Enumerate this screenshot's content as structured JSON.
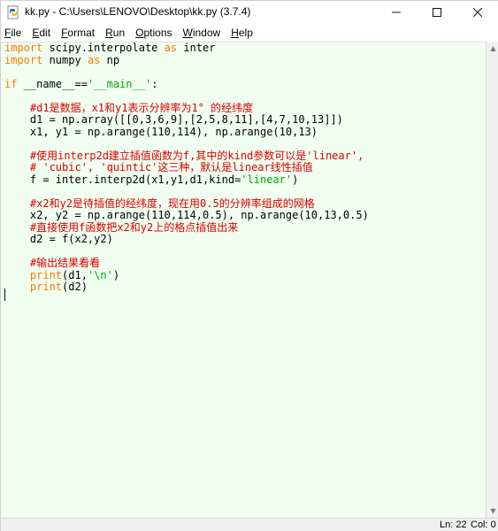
{
  "window": {
    "title": "kk.py - C:\\Users\\LENOVO\\Desktop\\kk.py (3.7.4)",
    "icon": "python-file-icon"
  },
  "menu": [
    "File",
    "Edit",
    "Format",
    "Run",
    "Options",
    "Window",
    "Help"
  ],
  "code": {
    "lines": [
      [
        {
          "t": "import",
          "c": "kw"
        },
        {
          "t": " scipy.interpolate ",
          "c": ""
        },
        {
          "t": "as",
          "c": "kw"
        },
        {
          "t": " inter",
          "c": ""
        }
      ],
      [
        {
          "t": "import",
          "c": "kw"
        },
        {
          "t": " numpy ",
          "c": ""
        },
        {
          "t": "as",
          "c": "kw"
        },
        {
          "t": " np",
          "c": ""
        }
      ],
      [],
      [
        {
          "t": "if",
          "c": "kw"
        },
        {
          "t": " __name__==",
          "c": ""
        },
        {
          "t": "'__main__'",
          "c": "str"
        },
        {
          "t": ":",
          "c": ""
        }
      ],
      [],
      [
        {
          "t": "    #d1是数据，x1和y1表示分辨率为1° 的经纬度",
          "c": "cm"
        }
      ],
      [
        {
          "t": "    d1 = np.array([[0,3,6,9],[2,5,8,11],[4,7,10,13]])",
          "c": ""
        }
      ],
      [
        {
          "t": "    x1, y1 = np.arange(110,114), np.arange(10,13)",
          "c": ""
        }
      ],
      [],
      [
        {
          "t": "    #使用interp2d建立插值函数为f,其中的kind参数可以是'linear',",
          "c": "cm"
        }
      ],
      [
        {
          "t": "    # 'cubic', 'quintic'这三种，默认是linear线性插值",
          "c": "cm"
        }
      ],
      [
        {
          "t": "    f = inter.interp2d(x1,y1,d1,kind=",
          "c": ""
        },
        {
          "t": "'linear'",
          "c": "str"
        },
        {
          "t": ")",
          "c": ""
        }
      ],
      [],
      [
        {
          "t": "    #x2和y2是待插值的经纬度，现在用0.5的分辨率组成的网格",
          "c": "cm"
        }
      ],
      [
        {
          "t": "    x2, y2 = np.arange(110,114,0.5), np.arange(10,13,0.5)",
          "c": ""
        }
      ],
      [
        {
          "t": "    #直接使用f函数把x2和y2上的格点插值出来",
          "c": "cm"
        }
      ],
      [
        {
          "t": "    d2 = f(x2,y2)",
          "c": ""
        }
      ],
      [],
      [
        {
          "t": "    #输出结果看看",
          "c": "cm"
        }
      ],
      [
        {
          "t": "    print",
          "c": "kw"
        },
        {
          "t": "(d1,",
          "c": ""
        },
        {
          "t": "'\\n'",
          "c": "str"
        },
        {
          "t": ")",
          "c": ""
        }
      ],
      [
        {
          "t": "    print",
          "c": "kw"
        },
        {
          "t": "(d2)",
          "c": ""
        }
      ],
      []
    ]
  },
  "status": {
    "line": "Ln: 22",
    "col": "Col: 0"
  },
  "colors": {
    "editor_bg": "#f0fff0",
    "keyword": "#ff7700",
    "string": "#00aa00",
    "comment": "#dd0000"
  }
}
